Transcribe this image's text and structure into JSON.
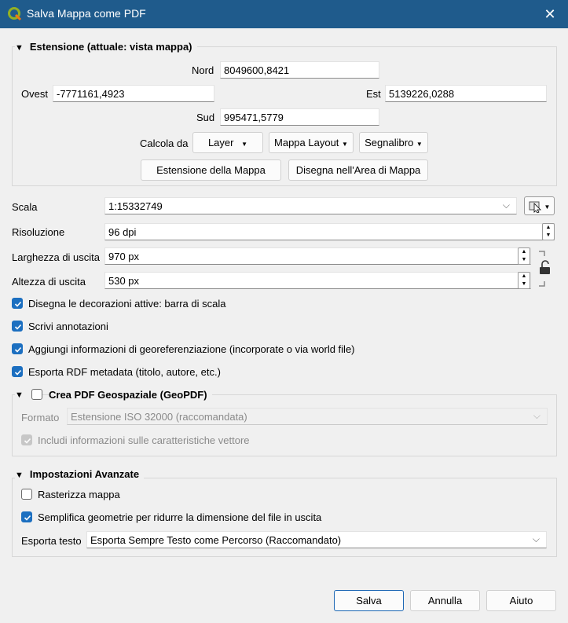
{
  "window": {
    "title": "Salva Mappa come PDF",
    "close_glyph": "✕",
    "accent": "#1f5b8c"
  },
  "extent": {
    "title": "Estensione (attuale: vista mappa)",
    "north_label": "Nord",
    "north_value": "8049600,8421",
    "west_label": "Ovest",
    "west_value": "-7771161,4923",
    "east_label": "Est",
    "east_value": "5139226,0288",
    "south_label": "Sud",
    "south_value": "995471,5779",
    "calc_label": "Calcola da",
    "layer_btn": "Layer",
    "layout_btn": "Mappa Layout",
    "bookmark_btn": "Segnalibro",
    "map_extent_btn": "Estensione della Mappa",
    "draw_btn": "Disegna nell'Area di Mappa"
  },
  "scale": {
    "label": "Scala",
    "value": "1:15332749"
  },
  "resolution": {
    "label": "Risoluzione",
    "value": "96 dpi"
  },
  "width": {
    "label": "Larghezza di uscita",
    "value": "970 px"
  },
  "height": {
    "label": "Altezza di uscita",
    "value": "530 px"
  },
  "options": {
    "decorations": "Disegna le decorazioni attive: barra di scala",
    "annotations": "Scrivi annotazioni",
    "georef": "Aggiungi informazioni di georeferenziazione (incorporate o via world file)",
    "rdf": "Esporta RDF metadata (titolo, autore, etc.)"
  },
  "geopdf": {
    "title": "Crea PDF Geospaziale (GeoPDF)",
    "format_label": "Formato",
    "format_value": "Estensione ISO 32000 (raccomandata)",
    "include_vector": "Includi informazioni sulle caratteristiche vettore"
  },
  "advanced": {
    "title": "Impostazioni Avanzate",
    "rasterize": "Rasterizza mappa",
    "simplify": "Semplifica geometrie per ridurre la dimensione del file in uscita",
    "text_export_label": "Esporta testo",
    "text_export_value": "Esporta Sempre Testo come Percorso (Raccomandato)"
  },
  "footer": {
    "save": "Salva",
    "cancel": "Annulla",
    "help": "Aiuto"
  }
}
